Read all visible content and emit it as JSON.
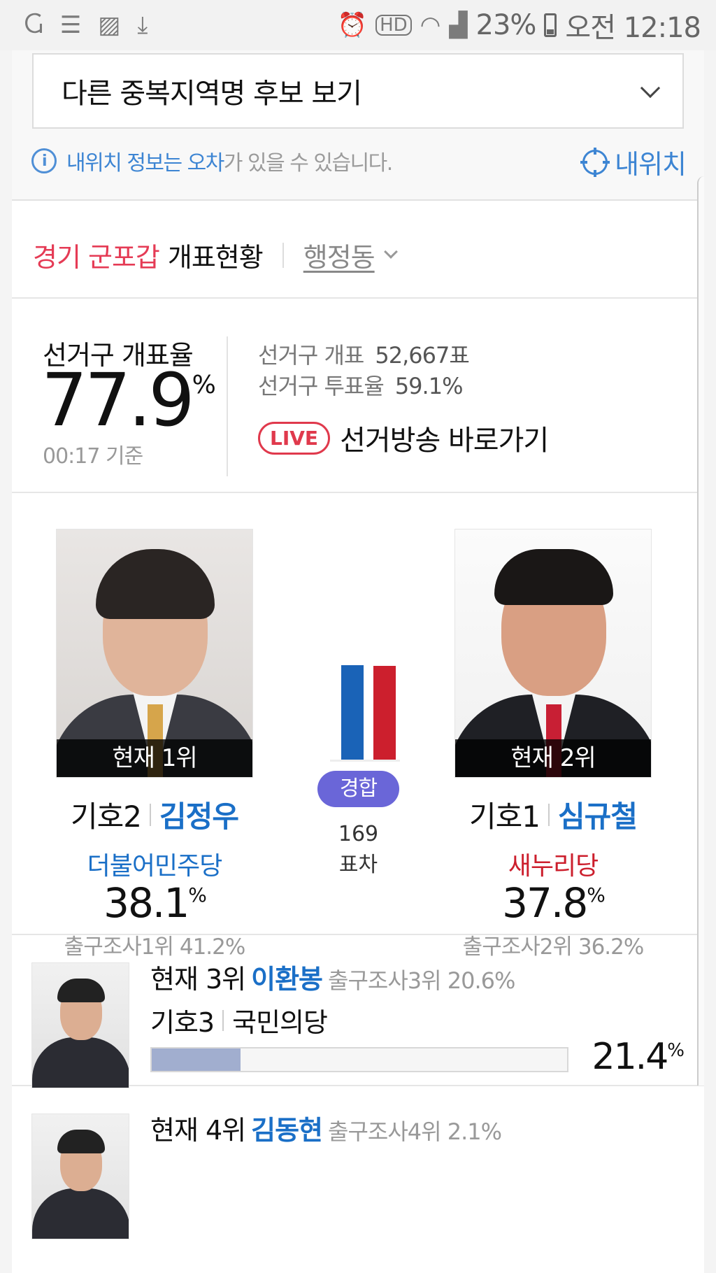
{
  "status_bar": {
    "battery": "23%",
    "time": "오전 12:18"
  },
  "region_select": {
    "label": "다른 중복지역명 후보 보기"
  },
  "location_note": {
    "highlight": "내위치 정보는 오차",
    "rest": "가 있을 수 있습니다.",
    "my_location": "내위치"
  },
  "header": {
    "region": "경기 군포갑",
    "title": "개표현황",
    "dong": "행정동"
  },
  "stats": {
    "rate_label": "선거구 개표율",
    "rate_value": "77.9",
    "rate_unit": "%",
    "rate_time": "00:17 기준",
    "count_label": "선거구 개표",
    "count_value": "52,667표",
    "turnout_label": "선거구 투표율",
    "turnout_value": "59.1%",
    "live_badge": "LIVE",
    "live_link": "선거방송 바로가기"
  },
  "main": {
    "left": {
      "rank": "현재 1위",
      "number": "기호2",
      "name": "김정우",
      "party": "더불어민주당",
      "pct": "38.1",
      "unit": "%",
      "exit": "출구조사1위 41.2%"
    },
    "right": {
      "rank": "현재 2위",
      "number": "기호1",
      "name": "심규철",
      "party": "새누리당",
      "pct": "37.8",
      "unit": "%",
      "exit": "출구조사2위 36.2%"
    },
    "badge": "경합",
    "diff_value": "169",
    "diff_label": "표차",
    "bars": {
      "left": 38.1,
      "right": 37.8
    }
  },
  "others": [
    {
      "rank": "현재 3위",
      "name": "이환봉",
      "exit": "출구조사3위 20.6%",
      "number": "기호3",
      "party": "국민의당",
      "pct": "21.4",
      "unit": "%",
      "fill": 0.214
    },
    {
      "rank": "현재 4위",
      "name": "김동현",
      "exit": "출구조사4위 2.1%"
    }
  ],
  "colors": {
    "party_left": "#1a6fc7",
    "party_right": "#cc1f2d",
    "bar_left": "#1a63b7",
    "bar_right": "#cc1f2d",
    "accent": "#e53b55",
    "badge": "#6a66d8"
  }
}
